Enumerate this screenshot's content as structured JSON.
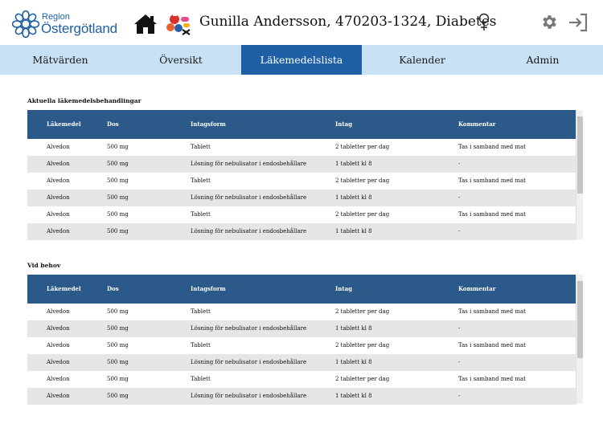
{
  "header": {
    "logo_small": "Region",
    "logo_big": "Östergötland",
    "patient_title": "Gunilla Andersson, 470203-1324, Diabetes",
    "icons": [
      "home-icon",
      "medication-icon",
      "female-icon",
      "gear-icon",
      "logout-icon"
    ]
  },
  "nav": {
    "tabs": [
      {
        "label": "Mätvärden"
      },
      {
        "label": "Översikt"
      },
      {
        "label": "Läkemedelslista"
      },
      {
        "label": "Kalender"
      },
      {
        "label": "Admin"
      }
    ],
    "active": "Läkemedelslista"
  },
  "colors": {
    "nav_bg": "#c9e1f4",
    "nav_active": "#1e5fa5",
    "table_header": "#2b5a8a",
    "row_alt": "#e6e6e6",
    "brand": "#1f5fa3"
  },
  "columns": [
    "Läkemedel",
    "Dos",
    "Intagsform",
    "Intag",
    "Kommentar"
  ],
  "sections": [
    {
      "title": "Aktuella läkemedelsbehandlingar",
      "rows": [
        [
          "Alvedon",
          "500 mg",
          "Tablett",
          "2 tabletter per dag",
          "Tas i samband med mat"
        ],
        [
          "Alvedon",
          "500 mg",
          "Lösning för nebulisator i endosbehållare",
          "1 tablett kl 8",
          "-"
        ],
        [
          "Alvedon",
          "500 mg",
          "Tablett",
          "2 tabletter per dag",
          "Tas i samband med mat"
        ],
        [
          "Alvedon",
          "500 mg",
          "Lösning för nebulisator i endosbehållare",
          "1 tablett kl 8",
          "-"
        ],
        [
          "Alvedon",
          "500 mg",
          "Tablett",
          "2 tabletter per dag",
          "Tas i samband med mat"
        ],
        [
          "Alvedon",
          "500 mg",
          "Lösning för nebulisator i endosbehållare",
          "1 tablett kl 8",
          "-"
        ]
      ]
    },
    {
      "title": "Vid behov",
      "rows": [
        [
          "Alvedon",
          "500 mg",
          "Tablett",
          "2 tabletter per dag",
          "Tas i samband med mat"
        ],
        [
          "Alvedon",
          "500 mg",
          "Lösning för nebulisator i endosbehållare",
          "1 tablett kl 8",
          "-"
        ],
        [
          "Alvedon",
          "500 mg",
          "Tablett",
          "2 tabletter per dag",
          "Tas i samband med mat"
        ],
        [
          "Alvedon",
          "500 mg",
          "Lösning för nebulisator i endosbehållare",
          "1 tablett kl 8",
          "-"
        ],
        [
          "Alvedon",
          "500 mg",
          "Tablett",
          "2 tabletter per dag",
          "Tas i samband med mat"
        ],
        [
          "Alvedon",
          "500 mg",
          "Lösning för nebulisator i endosbehållare",
          "1 tablett kl 8",
          "-"
        ]
      ]
    }
  ]
}
